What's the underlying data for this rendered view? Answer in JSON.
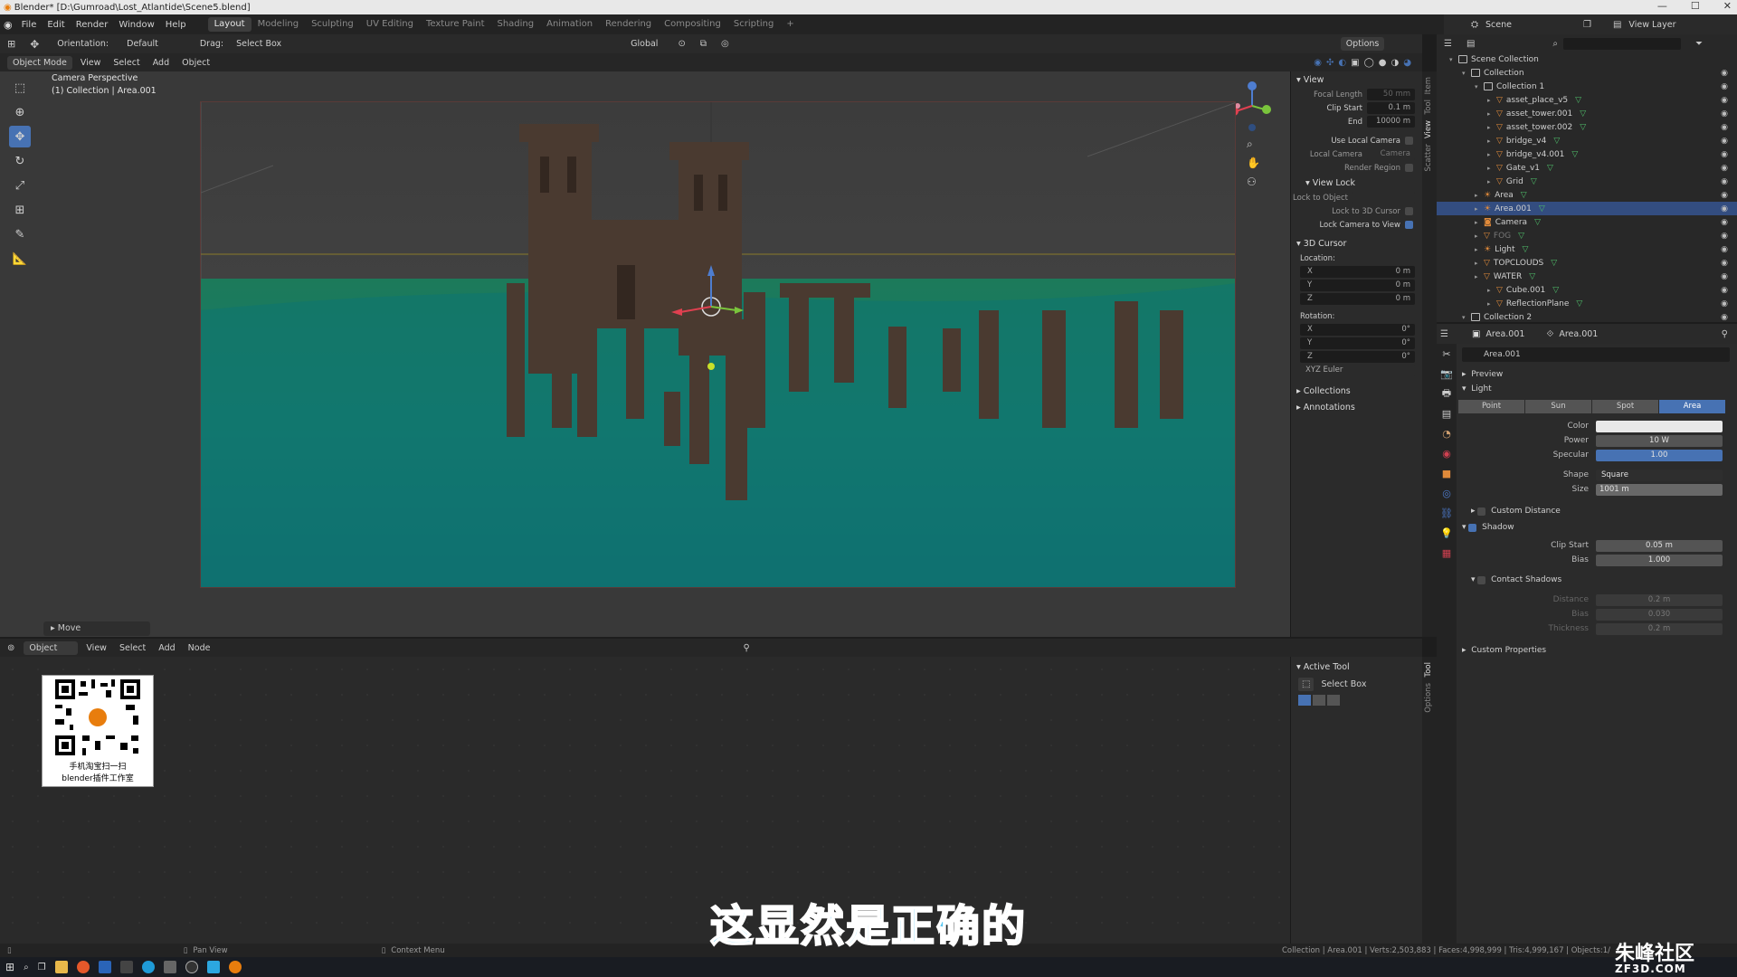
{
  "titlebar": {
    "title": "Blender* [D:\\Gumroad\\Lost_Atlantide\\Scene5.blend]"
  },
  "menubar": {
    "items": [
      "File",
      "Edit",
      "Render",
      "Window",
      "Help"
    ],
    "workspaces": [
      "Layout",
      "Modeling",
      "Sculpting",
      "UV Editing",
      "Texture Paint",
      "Shading",
      "Animation",
      "Rendering",
      "Compositing",
      "Scripting"
    ],
    "add": "+",
    "scene": "Scene",
    "view_layer": "View Layer"
  },
  "header": {
    "orientation_label": "Orientation:",
    "orientation": "Default",
    "drag_label": "Drag:",
    "drag": "Select Box",
    "transform": "Global",
    "options": "Options"
  },
  "viewport_header": {
    "mode": "Object Mode",
    "menus": [
      "View",
      "Select",
      "Add",
      "Object"
    ]
  },
  "viewport": {
    "perspective": "Camera Perspective",
    "collection": "(1) Collection | Area.001",
    "operator": "Move"
  },
  "npanel": {
    "view_title": "View",
    "focal_label": "Focal Length",
    "focal": "50 mm",
    "clip_start_label": "Clip Start",
    "clip_start": "0.1 m",
    "end_label": "End",
    "end": "10000 m",
    "use_local_camera": "Use Local Camera",
    "local_camera_label": "Local Camera",
    "local_camera": "Camera",
    "render_region": "Render Region",
    "view_lock": "View Lock",
    "lock_to_object": "Lock to Object",
    "lock_3d_cursor": "Lock to 3D Cursor",
    "lock_camera": "Lock Camera to View",
    "cursor_title": "3D Cursor",
    "location": "Location:",
    "rotation": "Rotation:",
    "x": "X",
    "y": "Y",
    "z": "Z",
    "loc_val": "0 m",
    "rot_val": "0°",
    "euler": "XYZ Euler",
    "collections": "Collections",
    "annotations": "Annotations",
    "tabs": [
      "Item",
      "Tool",
      "View",
      "Scatter"
    ]
  },
  "outliner": {
    "search_placeholder": "",
    "rows": [
      {
        "name": "Scene Collection",
        "type": "root",
        "indent": 0
      },
      {
        "name": "Collection",
        "type": "col",
        "indent": 1
      },
      {
        "name": "Collection 1",
        "type": "col",
        "indent": 2
      },
      {
        "name": "asset_place_v5",
        "type": "mesh",
        "indent": 3
      },
      {
        "name": "asset_tower.001",
        "type": "mesh",
        "indent": 3
      },
      {
        "name": "asset_tower.002",
        "type": "mesh",
        "indent": 3
      },
      {
        "name": "bridge_v4",
        "type": "mesh",
        "indent": 3
      },
      {
        "name": "bridge_v4.001",
        "type": "mesh",
        "indent": 3
      },
      {
        "name": "Gate_v1",
        "type": "mesh",
        "indent": 3
      },
      {
        "name": "Grid",
        "type": "mesh",
        "indent": 3
      },
      {
        "name": "Area",
        "type": "light",
        "indent": 2
      },
      {
        "name": "Area.001",
        "type": "light",
        "indent": 2,
        "selected": true
      },
      {
        "name": "Camera",
        "type": "cam",
        "indent": 2
      },
      {
        "name": "FOG",
        "type": "mesh",
        "indent": 2,
        "dim": true
      },
      {
        "name": "Light",
        "type": "light",
        "indent": 2
      },
      {
        "name": "TOPCLOUDS",
        "type": "mesh",
        "indent": 2
      },
      {
        "name": "WATER",
        "type": "mesh",
        "indent": 2
      },
      {
        "name": "Cube.001",
        "type": "mesh",
        "indent": 3
      },
      {
        "name": "ReflectionPlane",
        "type": "mesh",
        "indent": 3
      },
      {
        "name": "Collection 2",
        "type": "col",
        "indent": 1
      }
    ]
  },
  "properties": {
    "object": "Area.001",
    "data": "Area.001",
    "datablock": "Area.001",
    "preview": "Preview",
    "light": "Light",
    "types": [
      "Point",
      "Sun",
      "Spot",
      "Area"
    ],
    "active_type": "Area",
    "color_label": "Color",
    "power_label": "Power",
    "power": "10 W",
    "specular_label": "Specular",
    "specular": "1.00",
    "shape_label": "Shape",
    "shape": "Square",
    "size_label": "Size",
    "size": "1001 m",
    "custom_distance": "Custom Distance",
    "shadow": "Shadow",
    "clip_start_label": "Clip Start",
    "clip_start": "0.05 m",
    "bias_label": "Bias",
    "bias": "1.000",
    "contact_shadows": "Contact Shadows",
    "distance_label": "Distance",
    "distance": "0.2 m",
    "cbias_label": "Bias",
    "cbias": "0.030",
    "thickness_label": "Thickness",
    "thickness": "0.2 m",
    "custom_props": "Custom Properties"
  },
  "node_editor": {
    "type": "Object",
    "menus": [
      "View",
      "Select",
      "Add",
      "Node"
    ],
    "active_tool": "Active Tool",
    "select_box": "Select Box",
    "tabs": [
      "Tool",
      "Options"
    ]
  },
  "qr": {
    "line1": "手机淘宝扫一扫",
    "line2": "blender插件工作室"
  },
  "statusbar": {
    "pan": "Pan View",
    "context": "Context Menu",
    "stats": "Collection | Area.001 | Verts:2,503,883 | Faces:4,998,999 | Tris:4,999,167 | Objects:1/"
  },
  "subtitle": "这显然是正确的",
  "watermark": "朱峰社区",
  "watermark_url": "ZF3D.COM"
}
